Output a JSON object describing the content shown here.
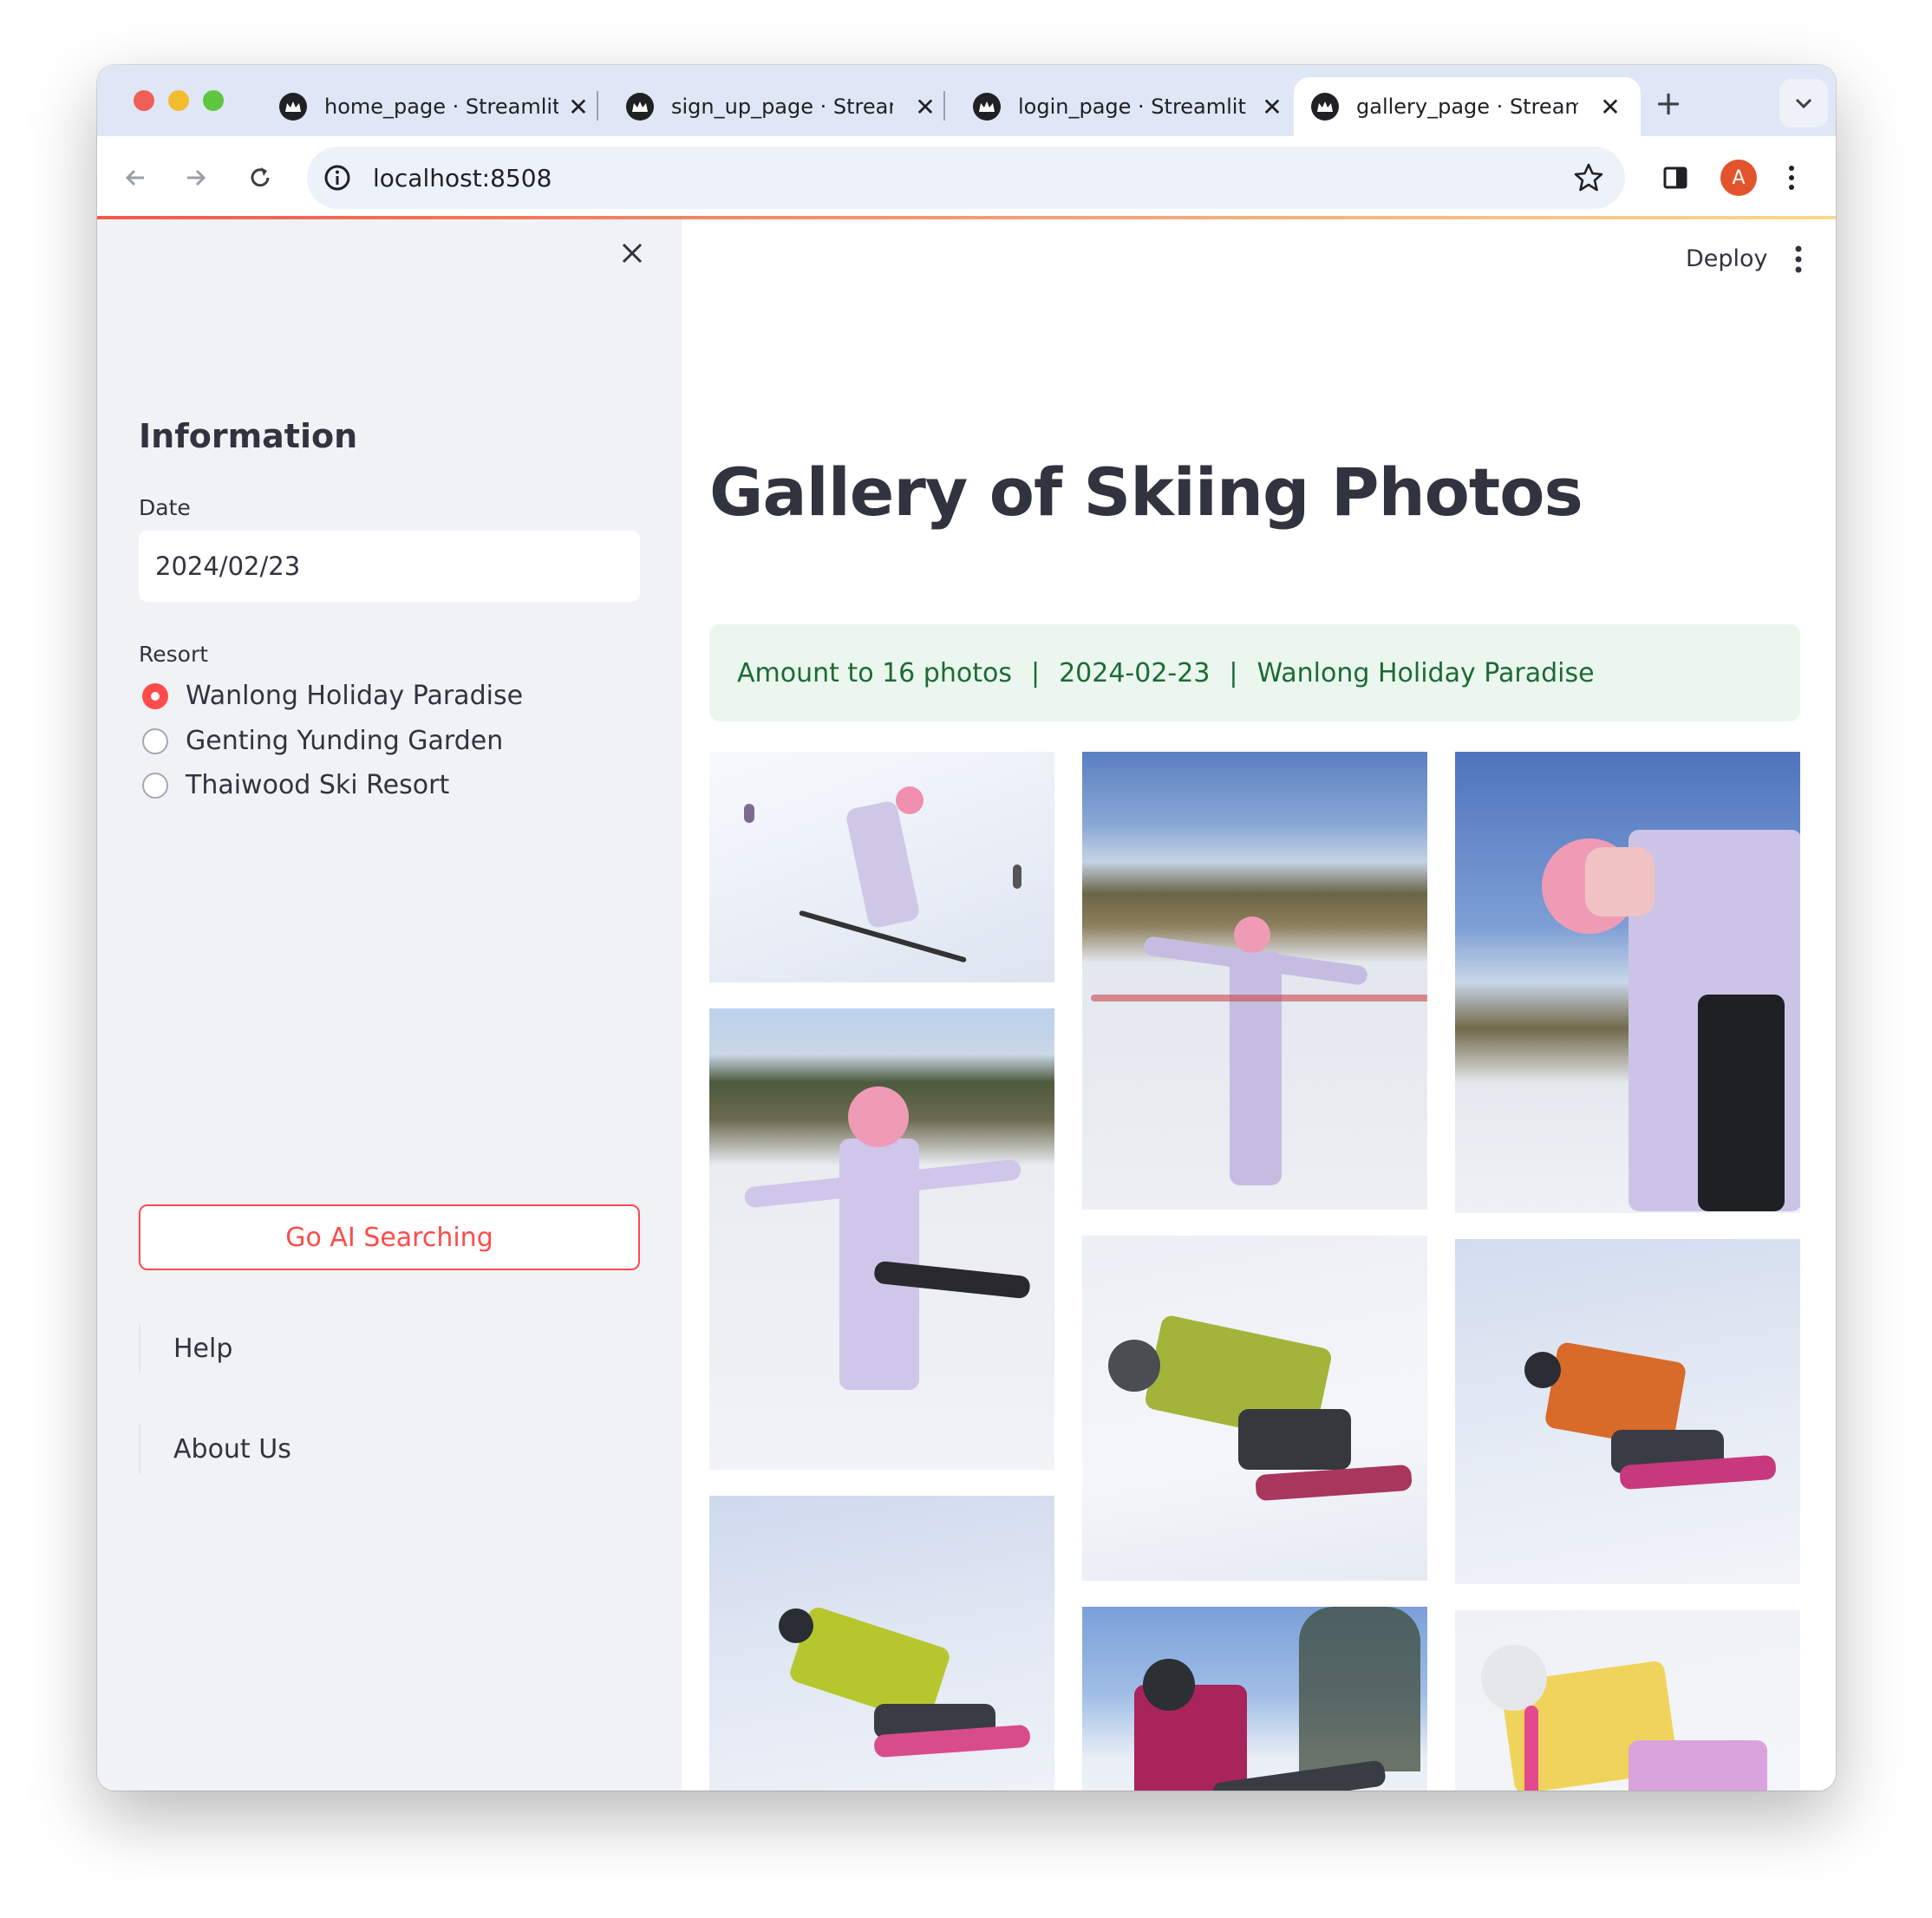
{
  "browser": {
    "tabs": [
      {
        "title": "home_page · Streamlit",
        "active": false
      },
      {
        "title": "sign_up_page · Streamlit",
        "active": false
      },
      {
        "title": "login_page · Streamlit",
        "active": false
      },
      {
        "title": "gallery_page · Streamlit",
        "active": true
      }
    ],
    "url": "localhost:8508",
    "profile_initial": "A"
  },
  "sidebar": {
    "section_title": "Information",
    "date_label": "Date",
    "date_value": "2024/02/23",
    "resort_label": "Resort",
    "resorts": [
      {
        "label": "Wanlong Holiday Paradise",
        "selected": true
      },
      {
        "label": "Genting Yunding Garden",
        "selected": false
      },
      {
        "label": "Thaiwood Ski Resort",
        "selected": false
      }
    ],
    "ai_button": "Go AI Searching",
    "links": [
      "Help",
      "About Us"
    ]
  },
  "main": {
    "deploy_label": "Deploy",
    "title": "Gallery of Skiing Photos",
    "summary": {
      "count_text": "Amount to 16 photos",
      "separator": "|",
      "date": "2024-02-23",
      "resort": "Wanlong Holiday Paradise"
    },
    "photos": [
      {
        "subject": "skier in lavender suit with poles",
        "palette": "snow"
      },
      {
        "subject": "skier with arms outstretched on slope",
        "palette": "sky-hill"
      },
      {
        "subject": "skier adjusting goggles close-up",
        "palette": "sky-hill"
      },
      {
        "subject": "skier balancing on one leg",
        "palette": "hill"
      },
      {
        "subject": "snowboarder in green jacket",
        "palette": "snow"
      },
      {
        "subject": "snowboarder in orange jacket",
        "palette": "snow"
      },
      {
        "subject": "snowboarder in yellow-green jacket",
        "palette": "snow"
      },
      {
        "subject": "snowboarder in magenta jacket",
        "palette": "sky-tree"
      },
      {
        "subject": "snowboarder in yellow jacket",
        "palette": "snow"
      }
    ]
  },
  "colors": {
    "accent": "#ff4b4b",
    "sidebar_bg": "#f0f2f6",
    "info_bg": "#ebf7ee",
    "info_text": "#1b6b34"
  }
}
